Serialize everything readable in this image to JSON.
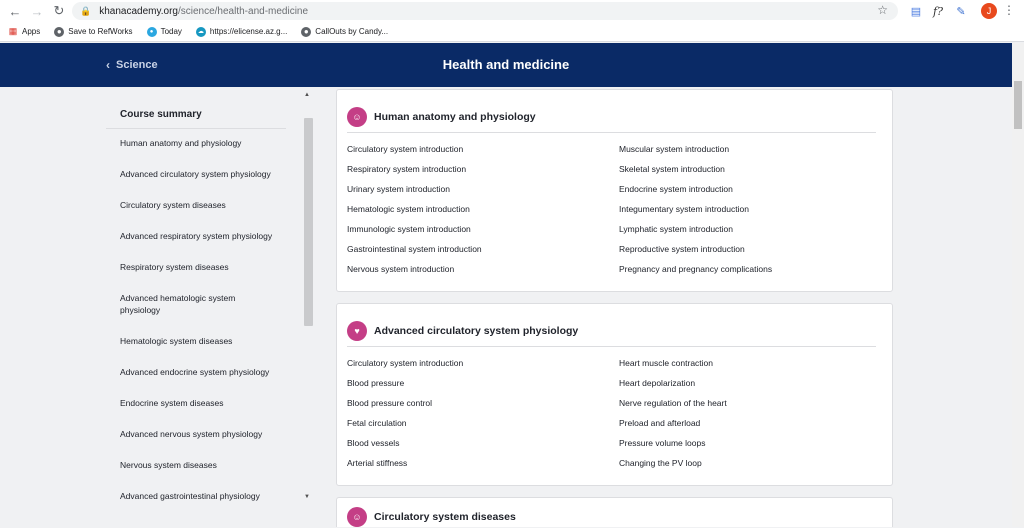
{
  "browser": {
    "url_host": "khanacademy.org",
    "url_path": "/science/health-and-medicine",
    "profile_initial": "J",
    "bookmarks": [
      {
        "label": "Apps"
      },
      {
        "label": "Save to RefWorks"
      },
      {
        "label": "Today"
      },
      {
        "label": "https://elicense.az.g..."
      },
      {
        "label": "CallOuts by Candy..."
      }
    ]
  },
  "header": {
    "back_label": "Science",
    "title": "Health and medicine",
    "background": "#0a2a66"
  },
  "sidebar": {
    "heading": "Course summary",
    "items": [
      {
        "label": "Human anatomy and physiology"
      },
      {
        "label": "Advanced circulatory system physiology"
      },
      {
        "label": "Circulatory system diseases"
      },
      {
        "label": "Advanced respiratory system physiology"
      },
      {
        "label": "Respiratory system diseases"
      },
      {
        "label": "Advanced hematologic system physiology"
      },
      {
        "label": "Hematologic system diseases"
      },
      {
        "label": "Advanced endocrine system physiology"
      },
      {
        "label": "Endocrine system diseases"
      },
      {
        "label": "Advanced nervous system physiology"
      },
      {
        "label": "Nervous system diseases"
      },
      {
        "label": "Advanced gastrointestinal physiology"
      }
    ]
  },
  "cards": [
    {
      "title": "Human anatomy and physiology",
      "left": [
        "Circulatory system introduction",
        "Respiratory system introduction",
        "Urinary system introduction",
        "Hematologic system introduction",
        "Immunologic system introduction",
        "Gastrointestinal system introduction",
        "Nervous system introduction"
      ],
      "right": [
        "Muscular system introduction",
        "Skeletal system introduction",
        "Endocrine system introduction",
        "Integumentary system introduction",
        "Lymphatic system introduction",
        "Reproductive system introduction",
        "Pregnancy and pregnancy complications"
      ]
    },
    {
      "title": "Advanced circulatory system physiology",
      "left": [
        "Circulatory system introduction",
        "Blood pressure",
        "Blood pressure control",
        "Fetal circulation",
        "Blood vessels",
        "Arterial stiffness"
      ],
      "right": [
        "Heart muscle contraction",
        "Heart depolarization",
        "Nerve regulation of the heart",
        "Preload and afterload",
        "Pressure volume loops",
        "Changing the PV loop"
      ]
    },
    {
      "title": "Circulatory system diseases",
      "left": [],
      "right": []
    }
  ],
  "colors": {
    "accent": "#c43e86",
    "header": "#0a2a66"
  }
}
